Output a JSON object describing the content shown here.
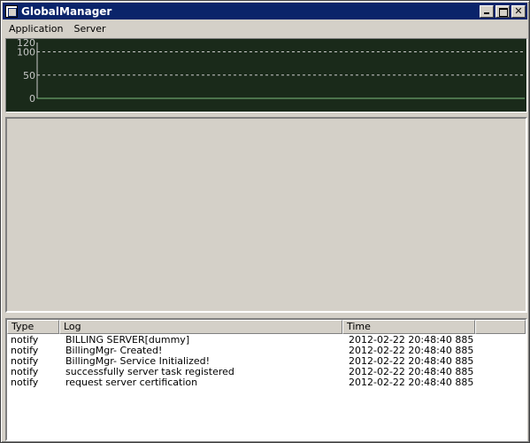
{
  "window": {
    "title": "GlobalManager"
  },
  "menu": {
    "items": [
      "Application",
      "Server"
    ]
  },
  "chart_data": {
    "type": "line",
    "x": [],
    "series": [
      {
        "values": []
      }
    ],
    "ylim": [
      0,
      120
    ],
    "yticks": [
      0,
      50,
      100,
      120
    ],
    "grid": true,
    "colors": {
      "background": "#1a2a1a",
      "grid": "#c8c8c8",
      "axis": "#c8c8c8",
      "line": "#7fbf7f"
    }
  },
  "log": {
    "columns": {
      "type": "Type",
      "log": "Log",
      "time": "Time"
    },
    "rows": [
      {
        "type": "notify",
        "log": "BILLING SERVER[dummy]",
        "time": "2012-02-22 20:48:40 885"
      },
      {
        "type": "notify",
        "log": "BillingMgr- Created!",
        "time": "2012-02-22 20:48:40 885"
      },
      {
        "type": "notify",
        "log": "BillingMgr- Service Initialized!",
        "time": "2012-02-22 20:48:40 885"
      },
      {
        "type": "notify",
        "log": "successfully server task registered",
        "time": "2012-02-22 20:48:40 885"
      },
      {
        "type": "notify",
        "log": "request server certification",
        "time": "2012-02-22 20:48:40 885"
      }
    ]
  }
}
